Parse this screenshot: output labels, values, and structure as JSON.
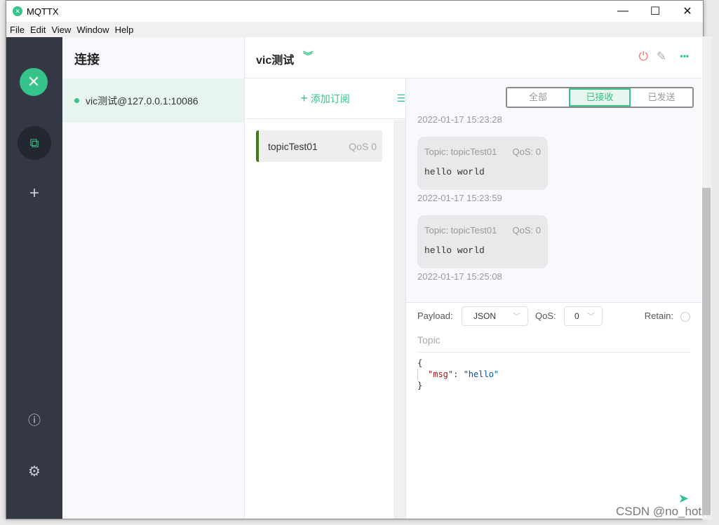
{
  "window": {
    "title": "MQTTX",
    "minimize": "—",
    "maximize": "☐",
    "close": "✕"
  },
  "menu": [
    "File",
    "Edit",
    "View",
    "Window",
    "Help"
  ],
  "connections": {
    "heading": "连接",
    "items": [
      {
        "label": "vic测试@127.0.0.1:10086",
        "status_color": "#34c388"
      }
    ]
  },
  "header": {
    "name": "vic测试",
    "chevron": "︾",
    "power": "⏻",
    "edit": "✎",
    "more": "•••"
  },
  "topics": {
    "add_label": "添加订阅",
    "add_icon": "+",
    "list_icon": "☰",
    "items": [
      {
        "name": "topicTest01",
        "qos": "QoS 0"
      }
    ]
  },
  "filter": {
    "tabs": [
      "全部",
      "已接收",
      "已发送"
    ],
    "active": 1
  },
  "messages": {
    "first_time": "2022-01-17 15:23:28",
    "items": [
      {
        "topic": "Topic: topicTest01",
        "qos": "QoS: 0",
        "payload": "hello world",
        "time": "2022-01-17 15:23:59"
      },
      {
        "topic": "Topic: topicTest01",
        "qos": "QoS: 0",
        "payload": "hello world",
        "time": "2022-01-17 15:25:08"
      }
    ]
  },
  "publish": {
    "payload_label": "Payload:",
    "payload_format": "JSON",
    "qos_label": "QoS:",
    "qos_value": "0",
    "retain_label": "Retain:",
    "topic_placeholder": "Topic",
    "code": {
      "open": "{",
      "key": "\"msg\"",
      "colon": ": ",
      "value": "\"hello\"",
      "close": "}"
    },
    "send_icon": "➤"
  },
  "watermark": "CSDN @no_hot",
  "colors": {
    "accent": "#34c388",
    "nav": "#333844",
    "danger": "#f56c6c"
  }
}
